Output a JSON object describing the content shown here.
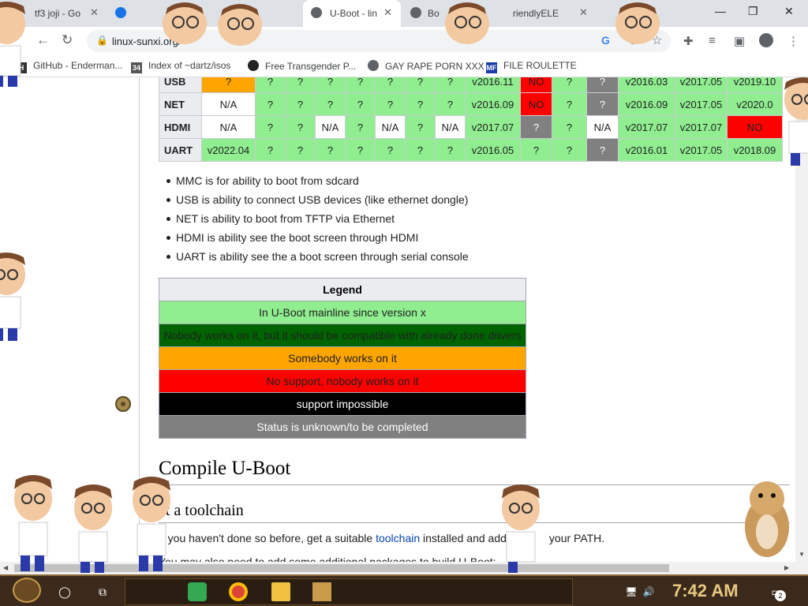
{
  "browser": {
    "tabs": [
      {
        "title": "tf3 joji - Go",
        "close": "✕",
        "active": false
      },
      {
        "title": "",
        "close": "✕",
        "active": false
      },
      {
        "title": "U-Boot - lin",
        "close": "✕",
        "active": true
      },
      {
        "title": "Bo",
        "close": "",
        "active": false
      },
      {
        "title": "riendlyELE",
        "close": "✕",
        "active": false
      }
    ],
    "window_controls": {
      "minimize": "—",
      "maximize": "❐",
      "close": "✕"
    },
    "url": "linux-sunxi.org/",
    "bookmarks": [
      "GitHub - Enderman...",
      "Index of ~dartz/isos",
      "Free Transgender P...",
      "GAY RAPE PORN XXX",
      "FILE ROULETTE"
    ]
  },
  "support_table": {
    "rows": [
      {
        "label": "USB",
        "cells": [
          [
            "?",
            "orange"
          ],
          [
            "?",
            "green"
          ],
          [
            "?",
            "green"
          ],
          [
            "?",
            "green"
          ],
          [
            "?",
            "green"
          ],
          [
            "?",
            "green"
          ],
          [
            "?",
            "green"
          ],
          [
            "?",
            "green"
          ],
          [
            "v2016.11",
            "green"
          ],
          [
            "NO",
            "red"
          ],
          [
            "?",
            "green"
          ],
          [
            "?",
            "grey"
          ],
          [
            "v2016.03",
            "green"
          ],
          [
            "v2017.05",
            "green"
          ],
          [
            "v2019.10",
            "green"
          ]
        ]
      },
      {
        "label": "NET",
        "cells": [
          [
            "N/A",
            "white"
          ],
          [
            "?",
            "green"
          ],
          [
            "?",
            "green"
          ],
          [
            "?",
            "green"
          ],
          [
            "?",
            "green"
          ],
          [
            "?",
            "green"
          ],
          [
            "?",
            "green"
          ],
          [
            "?",
            "green"
          ],
          [
            "v2016.09",
            "green"
          ],
          [
            "NO",
            "red"
          ],
          [
            "?",
            "green"
          ],
          [
            "?",
            "grey"
          ],
          [
            "v2016.09",
            "green"
          ],
          [
            "v2017.05",
            "green"
          ],
          [
            "v2020.0",
            "green"
          ]
        ]
      },
      {
        "label": "HDMI",
        "cells": [
          [
            "N/A",
            "white"
          ],
          [
            "?",
            "green"
          ],
          [
            "?",
            "green"
          ],
          [
            "N/A",
            "white"
          ],
          [
            "?",
            "green"
          ],
          [
            "N/A",
            "white"
          ],
          [
            "?",
            "green"
          ],
          [
            "N/A",
            "white"
          ],
          [
            "v2017.07",
            "green"
          ],
          [
            "?",
            "grey"
          ],
          [
            "?",
            "green"
          ],
          [
            "N/A",
            "white"
          ],
          [
            "v2017.07",
            "green"
          ],
          [
            "v2017.07",
            "green"
          ],
          [
            "NO",
            "red"
          ]
        ]
      },
      {
        "label": "UART",
        "cells": [
          [
            "v2022.04",
            "green"
          ],
          [
            "?",
            "green"
          ],
          [
            "?",
            "green"
          ],
          [
            "?",
            "green"
          ],
          [
            "?",
            "green"
          ],
          [
            "?",
            "green"
          ],
          [
            "?",
            "green"
          ],
          [
            "?",
            "green"
          ],
          [
            "v2016.05",
            "green"
          ],
          [
            "?",
            "green"
          ],
          [
            "?",
            "green"
          ],
          [
            "?",
            "grey"
          ],
          [
            "v2016.01",
            "green"
          ],
          [
            "v2017.05",
            "green"
          ],
          [
            "v2018.09",
            "green"
          ]
        ]
      }
    ]
  },
  "notes": [
    "MMC is for ability to boot from sdcard",
    "USB is ability to connect USB devices (like ethernet dongle)",
    "NET is ability to boot from TFTP via Ethernet",
    "HDMI is ability see the boot screen through HDMI",
    "UART is ability see the a boot screen through serial console"
  ],
  "legend": {
    "title": "Legend",
    "rows": [
      {
        "text": "In U-Boot mainline since version x",
        "bg": "#90ee90",
        "fg": "#202122"
      },
      {
        "text": "Nobody works on it, but it should be compatible with already done drivers",
        "bg": "#006400",
        "fg": "#202122"
      },
      {
        "text": "Somebody works on it",
        "bg": "#ffa500",
        "fg": "#202122"
      },
      {
        "text": "No support, nobody works on it",
        "bg": "#ff0000",
        "fg": "#202122"
      },
      {
        "text": "support impossible",
        "bg": "#000000",
        "fg": "#ffffff"
      },
      {
        "text": "Status is unknown/to be completed",
        "bg": "#808080",
        "fg": "#ffffff"
      }
    ]
  },
  "colors": {
    "green": "#90ee90",
    "red": "#ff0000",
    "orange": "#ffa500",
    "grey": "#808080",
    "white": "#ffffff"
  },
  "article": {
    "h2": "Compile U-Boot",
    "h3": "et a toolchain",
    "p1_pre": "If you haven't done so before, get a suitable ",
    "p1_link": "toolchain",
    "p1_post": " installed and add",
    "p1_tail": "your PATH.",
    "p2": "You may also need to add some additional packages to build U-Boot:"
  },
  "taskbar": {
    "time": "7:42 AM",
    "notif_count": "2"
  }
}
